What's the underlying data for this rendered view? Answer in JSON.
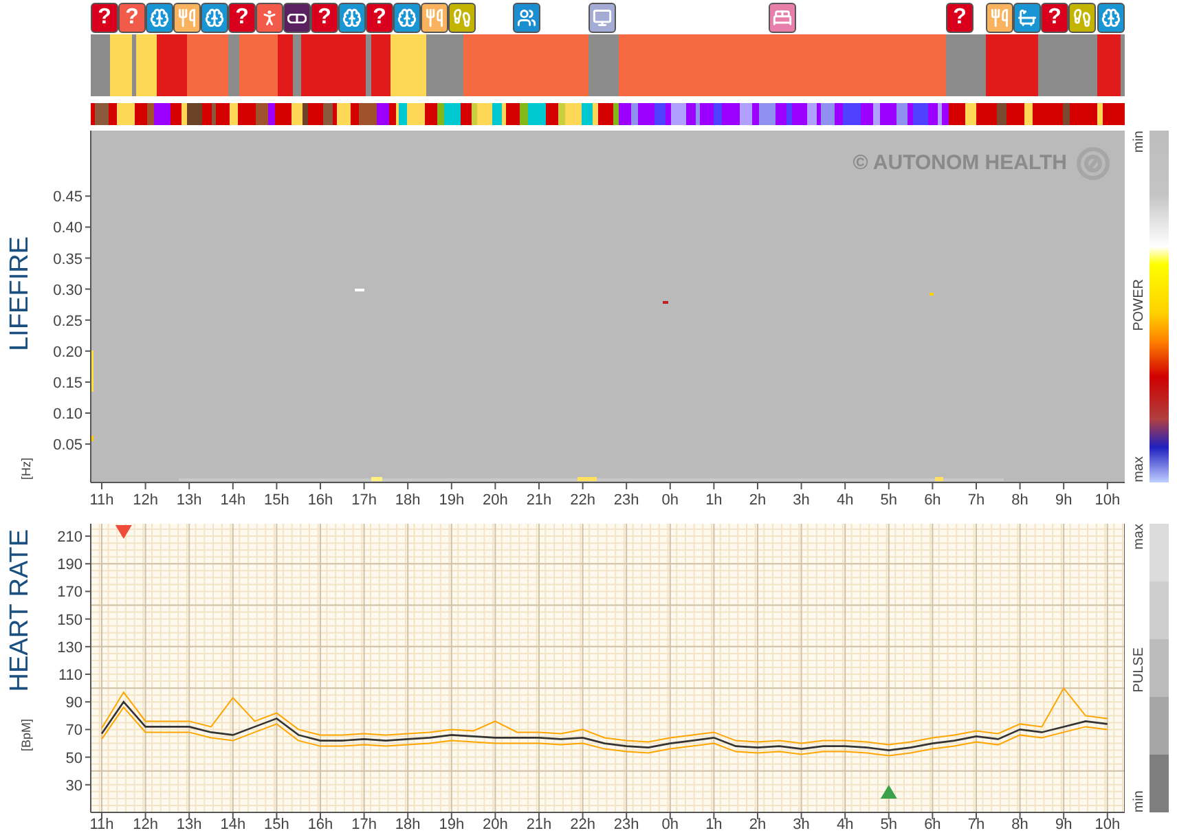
{
  "activity_timeline": {
    "segments": [
      {
        "color": "#8c8c8c",
        "marker": {
          "kind": "unknown",
          "color": "#d8001c",
          "glyph": "?"
        }
      },
      {
        "color": "#fdd756",
        "marker": {
          "kind": "unknown",
          "color": "#f25a4a",
          "glyph": "?"
        }
      },
      {
        "color": "#8c8c8c"
      },
      {
        "color": "#fdd756",
        "marker": {
          "kind": "mind",
          "color": "#1a95d3"
        }
      },
      {
        "color": "#e11a1a",
        "marker": {
          "kind": "meal",
          "color": "#f9b35e"
        }
      },
      {
        "color": "#f56a40",
        "marker": {
          "kind": "mind",
          "color": "#1a95d3"
        }
      },
      {
        "color": "#8c8c8c",
        "marker": {
          "kind": "unknown",
          "color": "#d8001c",
          "glyph": "?"
        }
      },
      {
        "color": "#f56a40",
        "marker": {
          "kind": "exercise",
          "color": "#f25a4a"
        }
      },
      {
        "color": "#e11a1a",
        "marker": {
          "kind": "medication",
          "color": "#5a2060"
        }
      },
      {
        "color": "#8c8c8c",
        "marker": {
          "kind": "unknown",
          "color": "#d8001c",
          "glyph": "?"
        }
      },
      {
        "color": "#e11a1a",
        "marker": {
          "kind": "mind",
          "color": "#1a95d3"
        }
      },
      {
        "color": "#8c8c8c",
        "marker": {
          "kind": "unknown",
          "color": "#d8001c",
          "glyph": "?"
        }
      },
      {
        "color": "#e11a1a",
        "marker": {
          "kind": "mind",
          "color": "#1a95d3"
        }
      },
      {
        "color": "#fdd756",
        "marker": {
          "kind": "meal",
          "color": "#f9b35e"
        }
      },
      {
        "color": "#8c8c8c",
        "marker": {
          "kind": "walk",
          "color": "#c2b400"
        }
      },
      {
        "color": "#f56a40",
        "marker": {
          "kind": "meeting",
          "color": "#1a8ed0"
        }
      },
      {
        "color": "#8c8c8c",
        "marker": {
          "kind": "screen",
          "color": "#a4acd6"
        }
      },
      {
        "color": "#f56a40",
        "marker": {
          "kind": "sleep",
          "color": "#e87eaa"
        }
      },
      {
        "color": "#8c8c8c",
        "marker": {
          "kind": "unknown",
          "color": "#d8001c",
          "glyph": "?"
        }
      },
      {
        "color": "#e11a1a",
        "marker": {
          "kind": "meal",
          "color": "#f9b35e"
        }
      },
      {
        "color": "#e11a1a",
        "marker": {
          "kind": "toilet",
          "color": "#1a95d3"
        }
      },
      {
        "color": "#8c8c8c",
        "marker": {
          "kind": "unknown",
          "color": "#d8001c",
          "glyph": "?"
        }
      },
      {
        "color": "#8c8c8c",
        "marker": {
          "kind": "walk",
          "color": "#c2b400"
        }
      },
      {
        "color": "#e11a1a",
        "marker": {
          "kind": "mind",
          "color": "#1a95d3"
        }
      },
      {
        "color": "#8c8c8c"
      }
    ]
  },
  "lifefire": {
    "title": "LIFEFIRE",
    "unit": "[Hz]",
    "watermark": "© AUTONOM HEALTH",
    "yticks": [
      "0.45",
      "0.40",
      "0.35",
      "0.30",
      "0.25",
      "0.20",
      "0.15",
      "0.10",
      "0.05"
    ],
    "xticks": [
      "11h",
      "12h",
      "13h",
      "14h",
      "15h",
      "16h",
      "17h",
      "18h",
      "19h",
      "20h",
      "21h",
      "22h",
      "23h",
      "0h",
      "1h",
      "2h",
      "3h",
      "4h",
      "5h",
      "6h",
      "7h",
      "8h",
      "9h",
      "10h"
    ],
    "legend": {
      "title": "POWER",
      "top": "min",
      "bottom": "max"
    }
  },
  "heart_rate": {
    "title": "HEART RATE",
    "unit": "[BpM]",
    "legend": {
      "title": "PULSE",
      "top": "max",
      "bottom": "min"
    },
    "chart_data": {
      "type": "line",
      "categories": [
        "11h",
        null,
        "12h",
        null,
        "13h",
        null,
        "14h",
        null,
        "15h",
        null,
        "16h",
        null,
        "17h",
        null,
        "18h",
        null,
        "19h",
        null,
        "20h",
        null,
        "21h",
        null,
        "22h",
        null,
        "23h",
        null,
        "0h",
        null,
        "1h",
        null,
        "2h",
        null,
        "3h",
        null,
        "4h",
        null,
        "5h",
        null,
        "6h",
        null,
        "7h",
        null,
        "8h",
        null,
        "9h",
        null,
        "10h"
      ],
      "series": [
        {
          "color": "#ffa500",
          "values": [
            71,
            97,
            76,
            76,
            76,
            72,
            93,
            76,
            82,
            70,
            66,
            66,
            67,
            66,
            67,
            68,
            70,
            69,
            76,
            68,
            68,
            67,
            70,
            64,
            62,
            61,
            64,
            66,
            68,
            62,
            61,
            62,
            60,
            62,
            62,
            61,
            59,
            61,
            64,
            66,
            69,
            67,
            74,
            72,
            100,
            80,
            78
          ]
        },
        {
          "color": "#ffa500",
          "values": [
            63,
            86,
            68,
            68,
            68,
            64,
            62,
            68,
            74,
            62,
            58,
            58,
            59,
            58,
            59,
            60,
            62,
            61,
            60,
            60,
            60,
            59,
            60,
            56,
            54,
            53,
            56,
            58,
            60,
            54,
            53,
            54,
            52,
            54,
            54,
            53,
            51,
            53,
            56,
            58,
            61,
            59,
            66,
            64,
            68,
            72,
            70
          ]
        },
        {
          "color": "#333333",
          "values": [
            67,
            90,
            72,
            72,
            72,
            68,
            66,
            72,
            78,
            66,
            62,
            62,
            63,
            62,
            63,
            64,
            66,
            65,
            64,
            64,
            64,
            63,
            64,
            60,
            58,
            57,
            60,
            62,
            64,
            58,
            57,
            58,
            56,
            58,
            58,
            57,
            55,
            57,
            60,
            62,
            65,
            63,
            70,
            68,
            72,
            76,
            74
          ]
        }
      ],
      "ylim": [
        10,
        219
      ],
      "grid": true,
      "yticks": [
        30,
        50,
        70,
        90,
        110,
        130,
        150,
        170,
        190,
        210
      ]
    }
  }
}
